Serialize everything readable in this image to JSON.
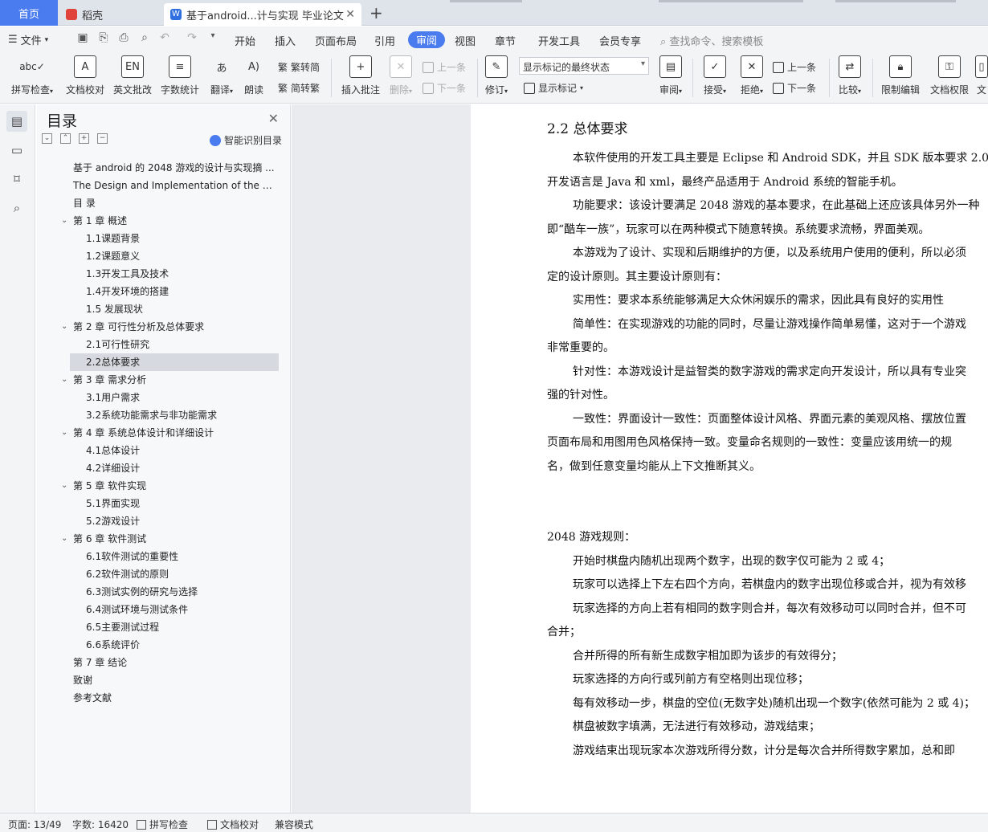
{
  "tabs": {
    "home": "首页",
    "docer": "稻壳",
    "active_doc": "基于android...计与实现 毕业论文",
    "close": "✕",
    "add": "+"
  },
  "menu": {
    "file": "文件",
    "items": [
      "开始",
      "插入",
      "页面布局",
      "引用",
      "审阅",
      "视图",
      "章节",
      "开发工具",
      "会员专享"
    ],
    "active": "审阅",
    "search": "查找命令、搜索模板"
  },
  "ribbon": {
    "spell_check": "拼写检查",
    "doc_proof": "文档校对",
    "eng_review": "英文批改",
    "word_count": "字数统计",
    "translate": "翻译",
    "read_aloud": "朗读",
    "to_traditional": "繁转简",
    "to_simplified": "简转繁",
    "insert_comment": "插入批注",
    "delete": "删除",
    "prev_comment": "上一条",
    "next_comment": "下一条",
    "revise": "修订",
    "markup_select": "显示标记的最终状态",
    "show_markup": "显示标记",
    "review": "审阅",
    "accept": "接受",
    "reject": "拒绝",
    "prev_change": "上一条",
    "next_change": "下一条",
    "compare": "比较",
    "restrict_edit": "限制编辑",
    "doc_permission": "文档权限",
    "doc_cut": "文"
  },
  "toc": {
    "title": "目录",
    "smart": "智能识别目录",
    "items": [
      {
        "level": 0,
        "text": "基于 android 的 2048 游戏的设计与实现摘 ..."
      },
      {
        "level": 0,
        "text": "The Design and Implementation of the 2 ..."
      },
      {
        "level": 0,
        "text": "目 录"
      },
      {
        "level": 1,
        "text": "第 1 章 概述"
      },
      {
        "level": 2,
        "text": "1.1课题背景"
      },
      {
        "level": 2,
        "text": "1.2课题意义"
      },
      {
        "level": 2,
        "text": "1.3开发工具及技术"
      },
      {
        "level": 2,
        "text": "1.4开发环境的搭建"
      },
      {
        "level": 2,
        "text": "1.5 发展现状"
      },
      {
        "level": 1,
        "text": "第 2 章 可行性分析及总体要求"
      },
      {
        "level": 2,
        "text": "2.1可行性研究"
      },
      {
        "level": 2,
        "text": "2.2总体要求",
        "selected": true
      },
      {
        "level": 1,
        "text": "第 3 章 需求分析"
      },
      {
        "level": 2,
        "text": "3.1用户需求"
      },
      {
        "level": 2,
        "text": "3.2系统功能需求与非功能需求"
      },
      {
        "level": 1,
        "text": "第 4 章 系统总体设计和详细设计"
      },
      {
        "level": 2,
        "text": "4.1总体设计"
      },
      {
        "level": 2,
        "text": "4.2详细设计"
      },
      {
        "level": 1,
        "text": "第 5 章 软件实现"
      },
      {
        "level": 2,
        "text": "5.1界面实现"
      },
      {
        "level": 2,
        "text": "5.2游戏设计"
      },
      {
        "level": 1,
        "text": "第 6 章 软件测试"
      },
      {
        "level": 2,
        "text": "6.1软件测试的重要性"
      },
      {
        "level": 2,
        "text": "6.2软件测试的原则"
      },
      {
        "level": 2,
        "text": "6.3测试实例的研究与选择"
      },
      {
        "level": 2,
        "text": "6.4测试环境与测试条件"
      },
      {
        "level": 2,
        "text": "6.5主要测试过程"
      },
      {
        "level": 2,
        "text": "6.6系统评价"
      },
      {
        "level": 0,
        "text": "第 7 章 结论"
      },
      {
        "level": 0,
        "text": "致谢"
      },
      {
        "level": 0,
        "text": "参考文献"
      }
    ]
  },
  "doc": {
    "heading": "2.2 总体要求",
    "paragraphs": [
      {
        "indent": true,
        "text": "本软件使用的开发工具主要是 Eclipse 和 Android SDK，并且 SDK 版本要求 2.0"
      },
      {
        "indent": false,
        "text": "开发语言是 Java 和 xml，最终产品适用于 Android 系统的智能手机。"
      },
      {
        "indent": true,
        "text": "功能要求：该设计要满足 2048 游戏的基本要求，在此基础上还应该具体另外一种"
      },
      {
        "indent": false,
        "text": "即“酷车一族”，玩家可以在两种模式下随意转换。系统要求流畅，界面美观。"
      },
      {
        "indent": true,
        "text": "本游戏为了设计、实现和后期维护的方便，以及系统用户使用的便利，所以必须"
      },
      {
        "indent": false,
        "text": "定的设计原则。其主要设计原则有："
      },
      {
        "indent": true,
        "text": "实用性：要求本系统能够满足大众休闲娱乐的需求，因此具有良好的实用性"
      },
      {
        "indent": true,
        "text": "简单性：在实现游戏的功能的同时，尽量让游戏操作简单易懂，这对于一个游戏"
      },
      {
        "indent": false,
        "text": "非常重要的。"
      },
      {
        "indent": true,
        "text": "针对性：本游戏设计是益智类的数字游戏的需求定向开发设计，所以具有专业突"
      },
      {
        "indent": false,
        "text": "强的针对性。"
      },
      {
        "indent": true,
        "text": "一致性：界面设计一致性：页面整体设计风格、界面元素的美观风格、摆放位置"
      },
      {
        "indent": false,
        "text": "页面布局和用图用色风格保持一致。变量命名规则的一致性：变量应该用统一的规"
      },
      {
        "indent": false,
        "text": "名，做到任意变量均能从上下文推断其义。"
      }
    ],
    "rules_title": "2048 游戏规则：",
    "rules": [
      {
        "indent": true,
        "text": "开始时棋盘内随机出现两个数字，出现的数字仅可能为  2 或  4；"
      },
      {
        "indent": true,
        "text": "玩家可以选择上下左右四个方向，若棋盘内的数字出现位移或合并，视为有效移"
      },
      {
        "indent": true,
        "text": "玩家选择的方向上若有相同的数字则合并，每次有效移动可以同时合并，但不可"
      },
      {
        "indent": false,
        "text": "合并；"
      },
      {
        "indent": true,
        "text": "合并所得的所有新生成数字相加即为该步的有效得分；"
      },
      {
        "indent": true,
        "text": "玩家选择的方向行或列前方有空格则出现位移；"
      },
      {
        "indent": true,
        "text": "每有效移动一步，棋盘的空位(无数字处)随机出现一个数字(依然可能为 2 或 4)；"
      },
      {
        "indent": true,
        "text": "棋盘被数字填满，无法进行有效移动，游戏结束；"
      },
      {
        "indent": true,
        "text": "游戏结束出现玩家本次游戏所得分数，计分是每次合并所得数字累加，总和即"
      }
    ]
  },
  "status": {
    "page": "页面: 13/49",
    "words": "字数: 16420",
    "spell": "拼写检查",
    "proof": "文档校对",
    "compat": "兼容模式"
  },
  "colors": {
    "accent": "#4a7cf0",
    "docer": "#e0433a",
    "wps_doc": "#2f6fe0"
  }
}
